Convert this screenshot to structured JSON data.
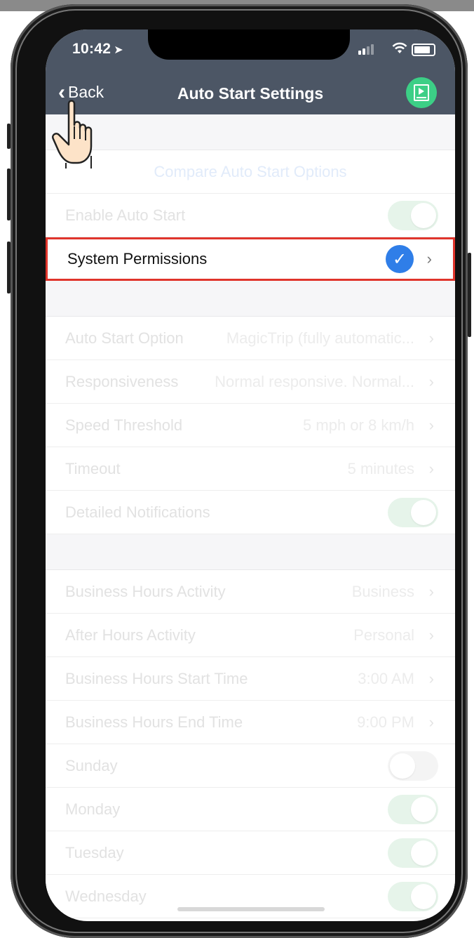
{
  "status": {
    "time": "10:42"
  },
  "nav": {
    "back_label": "Back",
    "title": "Auto Start Settings",
    "video_icon": "video-guide-icon"
  },
  "section1": {
    "compare_link": "Compare Auto Start Options",
    "enable_auto_start": {
      "label": "Enable Auto Start",
      "on": true
    },
    "system_permissions": {
      "label": "System Permissions",
      "checked": true
    }
  },
  "section2": {
    "rows": [
      {
        "label": "Auto Start Option",
        "value": "MagicTrip (fully automatic..."
      },
      {
        "label": "Responsiveness",
        "value": "Normal responsive. Normal..."
      },
      {
        "label": "Speed Threshold",
        "value": "5 mph or 8 km/h"
      },
      {
        "label": "Timeout",
        "value": "5 minutes"
      }
    ],
    "detailed_notifications": {
      "label": "Detailed Notifications",
      "on": true
    }
  },
  "section3": {
    "rows": [
      {
        "label": "Business Hours Activity",
        "value": "Business"
      },
      {
        "label": "After Hours Activity",
        "value": "Personal"
      },
      {
        "label": "Business Hours Start Time",
        "value": "3:00 AM"
      },
      {
        "label": "Business Hours End Time",
        "value": "9:00 PM"
      }
    ],
    "days": [
      {
        "label": "Sunday",
        "on": false
      },
      {
        "label": "Monday",
        "on": true
      },
      {
        "label": "Tuesday",
        "on": true
      },
      {
        "label": "Wednesday",
        "on": true
      }
    ]
  },
  "colors": {
    "nav_bg": "#4c5665",
    "accent_green": "#3ccf86",
    "check_blue": "#2f7ee8",
    "highlight_red": "#e0352c"
  }
}
